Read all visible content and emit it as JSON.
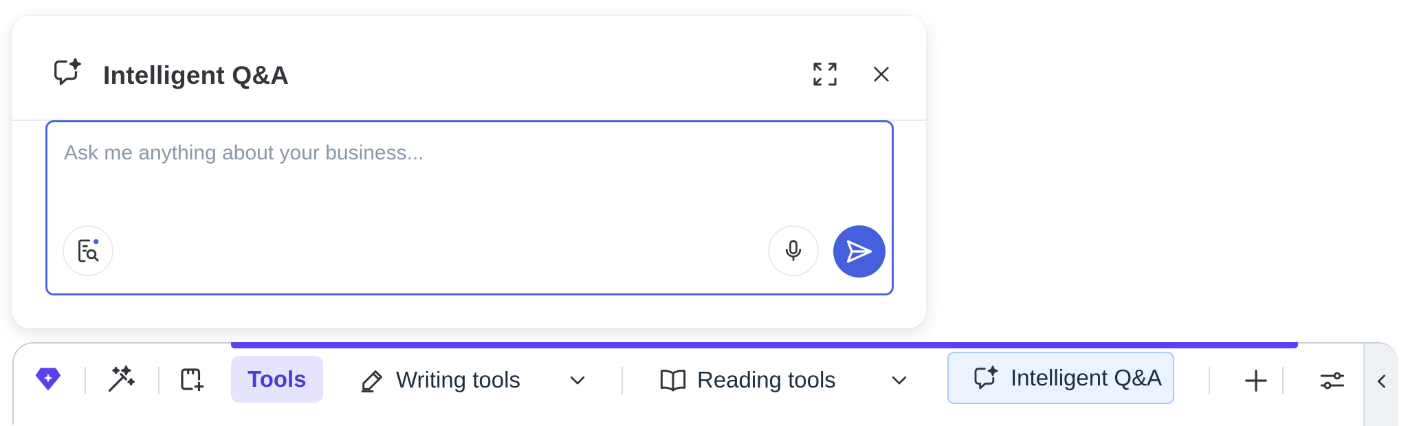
{
  "qa_panel": {
    "title": "Intelligent Q&A",
    "input": {
      "value": "",
      "placeholder": "Ask me anything about your business..."
    },
    "icons": {
      "title": "chat-sparkle-icon",
      "expand": "expand-icon",
      "close": "close-icon",
      "doc_search": "document-search-icon",
      "mic": "microphone-icon",
      "send": "send-icon"
    }
  },
  "toolbar": {
    "tools_label": "Tools",
    "writing_label": "Writing tools",
    "reading_label": "Reading tools",
    "qa_label": "Intelligent Q&A",
    "progress": 1.0,
    "icons": {
      "logo": "diamond-logo-icon",
      "magic": "magic-wand-icon",
      "add_note": "add-note-icon",
      "writing": "pencil-icon",
      "reading": "open-book-icon",
      "qa": "chat-sparkle-icon",
      "add": "plus-icon",
      "filters": "filter-sliders-icon",
      "collapse": "chevron-left-icon",
      "dropdown": "chevron-down-icon"
    }
  },
  "colors": {
    "accent": "#4660dd",
    "tools_active_bg": "#e6e3ff",
    "tools_active_text": "#4a3bd1",
    "progress": "#5b3ff0",
    "qa_active_bg": "#eaf3ff",
    "qa_active_border": "#aacbef",
    "logo": "#5b3ff0"
  }
}
